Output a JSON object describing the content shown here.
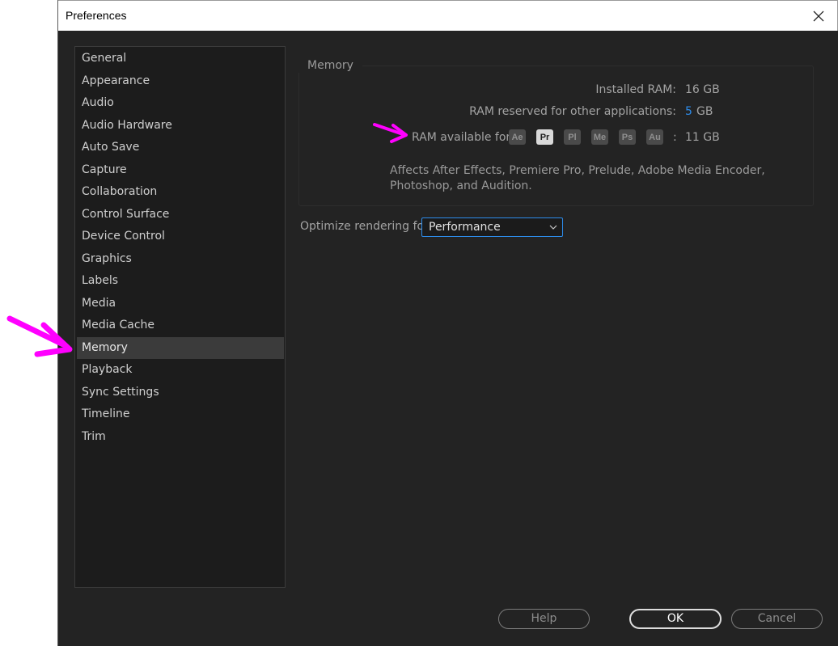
{
  "window": {
    "title": "Preferences",
    "close_icon": "close-icon"
  },
  "sidebar": {
    "items": [
      {
        "label": "General"
      },
      {
        "label": "Appearance"
      },
      {
        "label": "Audio"
      },
      {
        "label": "Audio Hardware"
      },
      {
        "label": "Auto Save"
      },
      {
        "label": "Capture"
      },
      {
        "label": "Collaboration"
      },
      {
        "label": "Control Surface"
      },
      {
        "label": "Device Control"
      },
      {
        "label": "Graphics"
      },
      {
        "label": "Labels"
      },
      {
        "label": "Media"
      },
      {
        "label": "Media Cache"
      },
      {
        "label": "Memory",
        "selected": true
      },
      {
        "label": "Playback"
      },
      {
        "label": "Sync Settings"
      },
      {
        "label": "Timeline"
      },
      {
        "label": "Trim"
      }
    ]
  },
  "memory": {
    "group_title": "Memory",
    "installed_label": "Installed RAM:",
    "installed_value": "16 GB",
    "reserved_label": "RAM reserved for other applications:",
    "reserved_value": "5",
    "reserved_unit": "GB",
    "available_label": "RAM available for",
    "apps": [
      "Ae",
      "Pr",
      "Pl",
      "Me",
      "Ps",
      "Au"
    ],
    "active_app": "Pr",
    "available_colon": ":",
    "available_value": "11 GB",
    "note_line1": "Affects After Effects, Premiere Pro, Prelude, Adobe Media Encoder,",
    "note_line2": "Photoshop, and Audition."
  },
  "optimize": {
    "label": "Optimize rendering for:",
    "selected": "Performance"
  },
  "buttons": {
    "help": "Help",
    "ok": "OK",
    "cancel": "Cancel"
  },
  "colors": {
    "accent": "#2d8ceb",
    "annotation_arrow": "#ff00ff",
    "background": "#232323"
  }
}
